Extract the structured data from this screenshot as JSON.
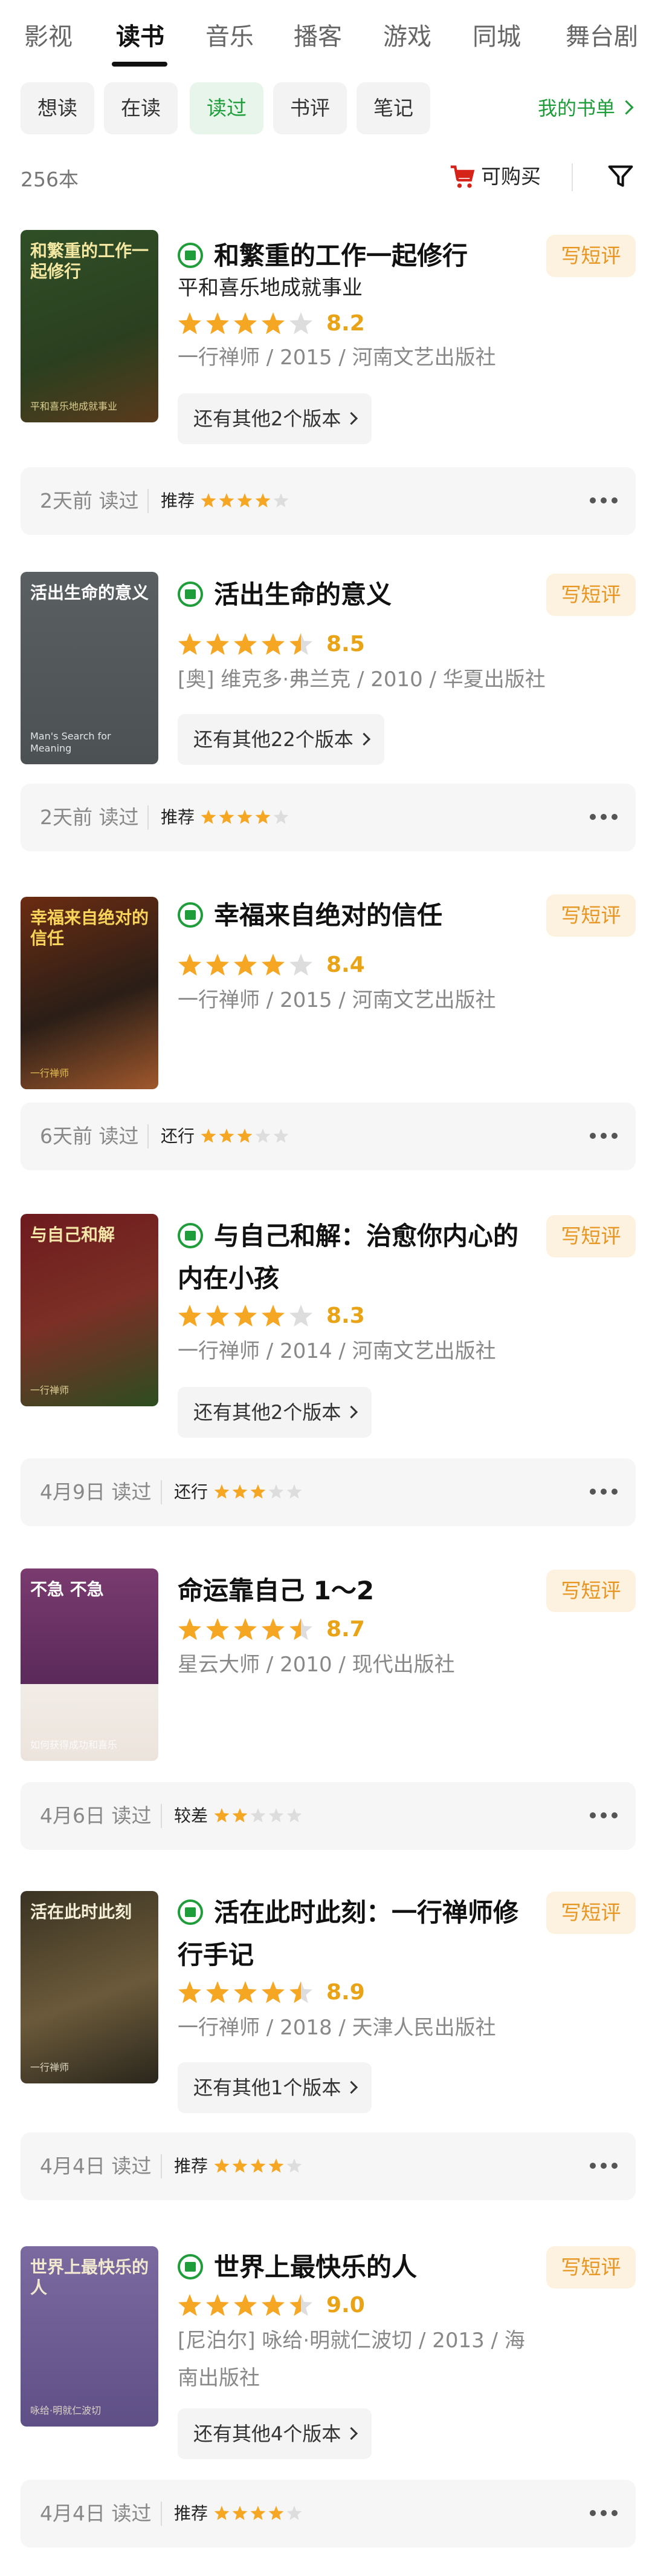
{
  "tabs": [
    "影视",
    "读书",
    "音乐",
    "播客",
    "游戏",
    "同城",
    "舞台剧"
  ],
  "active_tab": "读书",
  "filters": [
    "想读",
    "在读",
    "读过",
    "书评",
    "笔记"
  ],
  "active_filter": "读过",
  "my_booklist": "我的书单",
  "count_label": "256本",
  "buyable_label": "可购买",
  "review_button": "写短评",
  "colors": {
    "accent_green": "#1f9d3a",
    "star": "#f5a623",
    "review_bg": "#fdf1df",
    "review_text": "#e89622"
  },
  "books": [
    {
      "title": "和繁重的工作一起修行",
      "subtitle": "平和喜乐地成就事业",
      "rating_stars": 4,
      "score": "8.2",
      "meta": "一行禅师 / 2015 / 河南文艺出版社",
      "versions": "还有其他2个版本",
      "when": "2天前 读过",
      "verdict": "推荐",
      "verdict_stars": 4,
      "cover_text": "和繁重的工作一起修行",
      "cover_sub": "平和喜乐地成就事业"
    },
    {
      "title": "活出生命的意义",
      "rating_stars": 4.5,
      "score": "8.5",
      "meta": "[奥] 维克多·弗兰克 / 2010 / 华夏出版社",
      "versions": "还有其他22个版本",
      "when": "2天前 读过",
      "verdict": "推荐",
      "verdict_stars": 4,
      "cover_text": "活出生命的意义",
      "cover_sub": "Man's Search for Meaning"
    },
    {
      "title": "幸福来自绝对的信任",
      "rating_stars": 4,
      "score": "8.4",
      "meta": "一行禅师 / 2015 / 河南文艺出版社",
      "when": "6天前 读过",
      "verdict": "还行",
      "verdict_stars": 3,
      "cover_text": "幸福来自绝对的信任",
      "cover_sub": "一行禅师"
    },
    {
      "title": "与自己和解：治愈你内心的内在小孩",
      "rating_stars": 4,
      "score": "8.3",
      "meta": "一行禅师 / 2014 / 河南文艺出版社",
      "versions": "还有其他2个版本",
      "when": "4月9日 读过",
      "verdict": "还行",
      "verdict_stars": 3,
      "cover_text": "与自己和解",
      "cover_sub": "一行禅师"
    },
    {
      "title": "命运靠自己 1～2",
      "rating_stars": 4.5,
      "score": "8.7",
      "meta": "星云大师 / 2010 / 现代出版社",
      "when": "4月6日 读过",
      "verdict": "较差",
      "verdict_stars": 2,
      "cover_text": "不急 不急",
      "cover_sub": "如何获得成功和喜乐"
    },
    {
      "title": "活在此时此刻：一行禅师修行手记",
      "rating_stars": 4.5,
      "score": "8.9",
      "meta": "一行禅师 / 2018 / 天津人民出版社",
      "versions": "还有其他1个版本",
      "when": "4月4日 读过",
      "verdict": "推荐",
      "verdict_stars": 4,
      "cover_text": "活在此时此刻",
      "cover_sub": "一行禅师"
    },
    {
      "title": "世界上最快乐的人",
      "rating_stars": 4.5,
      "score": "9.0",
      "meta": "[尼泊尔] 咏给·明就仁波切 / 2013 / 海南出版社",
      "versions": "还有其他4个版本",
      "when": "4月4日 读过",
      "verdict": "推荐",
      "verdict_stars": 4,
      "cover_text": "世界上最快乐的人",
      "cover_sub": "咏给·明就仁波切"
    }
  ]
}
